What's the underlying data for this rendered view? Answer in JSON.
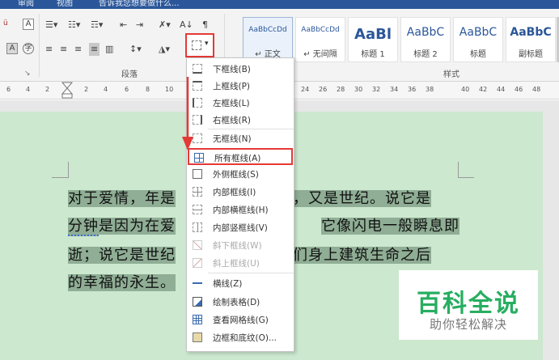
{
  "title_bar": {
    "tab_review": "审阅",
    "tab_view": "视图",
    "search_hint": "告诉我您想要做什么..."
  },
  "ribbon": {
    "paragraph_label": "段落",
    "styles_label": "样式",
    "sort_icon_label": "A↓",
    "styles": [
      {
        "sample": "AaBbCcDd",
        "name": "↵ 正文"
      },
      {
        "sample": "AaBbCcDd",
        "name": "↵ 无间隔"
      },
      {
        "sample": "AaBl",
        "name": "标题 1"
      },
      {
        "sample": "AaBbC",
        "name": "标题 2"
      },
      {
        "sample": "AaBbC",
        "name": "标题"
      },
      {
        "sample": "AaBbC",
        "name": "副标题"
      }
    ]
  },
  "ruler": {
    "left_nums": [
      "6",
      "4",
      "2"
    ],
    "right_nums": [
      "2",
      "4",
      "6",
      "8",
      "10",
      "24",
      "26",
      "28",
      "30",
      "32",
      "34",
      "36",
      "38",
      "40",
      "42",
      "44",
      "46",
      "48"
    ]
  },
  "document": {
    "line1_a": "对于爱情，年是",
    "line1_b": "钟，又是世纪。说它是",
    "line2_a": "分钟",
    "line2_b": "是因为在爱",
    "line2_c": "它像闪电一般瞬息即",
    "line3_a": "逝；说它是世纪",
    "line3_b": "我们身上建筑生命之后",
    "line4_a": "的幸福的永生。"
  },
  "border_menu": {
    "items": [
      {
        "label": "下框线(B)",
        "icon": "bottom-border-icon",
        "disabled": false
      },
      {
        "label": "上框线(P)",
        "icon": "top-border-icon",
        "disabled": false
      },
      {
        "label": "左框线(L)",
        "icon": "left-border-icon",
        "disabled": false
      },
      {
        "label": "右框线(R)",
        "icon": "right-border-icon",
        "disabled": false
      },
      {
        "label": "无框线(N)",
        "icon": "no-border-icon",
        "disabled": false
      },
      {
        "label": "所有框线(A)",
        "icon": "all-borders-icon",
        "disabled": false
      },
      {
        "label": "外侧框线(S)",
        "icon": "outside-borders-icon",
        "disabled": false
      },
      {
        "label": "内部框线(I)",
        "icon": "inside-borders-icon",
        "disabled": false
      },
      {
        "label": "内部横框线(H)",
        "icon": "inside-horizontal-border-icon",
        "disabled": false
      },
      {
        "label": "内部竖框线(V)",
        "icon": "inside-vertical-border-icon",
        "disabled": false
      },
      {
        "label": "斜下框线(W)",
        "icon": "diagonal-down-border-icon",
        "disabled": true
      },
      {
        "label": "斜上框线(U)",
        "icon": "diagonal-up-border-icon",
        "disabled": true
      },
      {
        "label": "横线(Z)",
        "icon": "horizontal-line-icon",
        "disabled": false
      },
      {
        "label": "绘制表格(D)",
        "icon": "draw-table-icon",
        "disabled": false
      },
      {
        "label": "查看网格线(G)",
        "icon": "view-gridlines-icon",
        "disabled": false
      },
      {
        "label": "边框和底纹(O)...",
        "icon": "borders-shading-icon",
        "disabled": false
      }
    ]
  },
  "watermark": {
    "title": "百科全说",
    "subtitle": "助你轻松解决"
  },
  "colors": {
    "accent_red": "#e53935",
    "word_blue": "#2b579a",
    "page_green": "#cce8cf",
    "watermark_green": "#27ae60"
  }
}
